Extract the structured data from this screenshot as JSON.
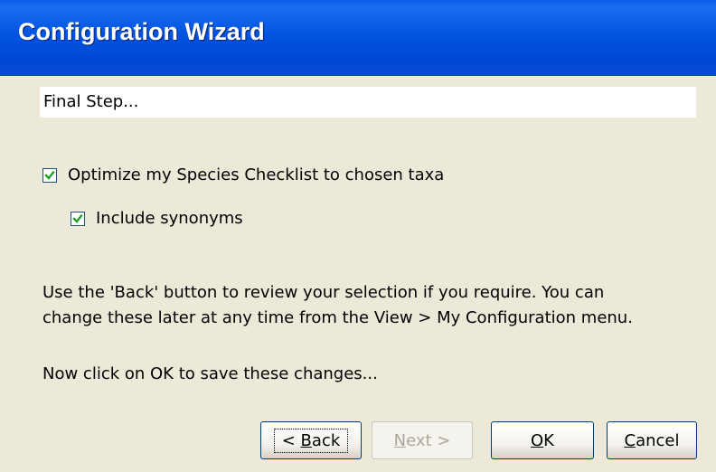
{
  "window": {
    "title": "Configuration Wizard"
  },
  "step": {
    "title": "Final Step..."
  },
  "options": {
    "optimize": {
      "label": "Optimize my Species Checklist to chosen taxa",
      "checked": true
    },
    "synonyms": {
      "label": "Include synonyms",
      "checked": true
    }
  },
  "info": {
    "line1": "Use the 'Back' button to review your selection if you require.  You can",
    "line2": "change these later at any time from the View > My Configuration menu.",
    "instruction": "Now click on OK to save these changes..."
  },
  "buttons": {
    "back_prefix": "< ",
    "back_mnemonic": "B",
    "back_rest": "ack",
    "next_mnemonic": "N",
    "next_rest": "ext >",
    "ok_mnemonic": "O",
    "ok_rest": "K",
    "cancel_mnemonic": "C",
    "cancel_rest": "ancel"
  },
  "colors": {
    "titlebar": "#0054e3",
    "face": "#ece9d8",
    "check": "#21a121"
  }
}
